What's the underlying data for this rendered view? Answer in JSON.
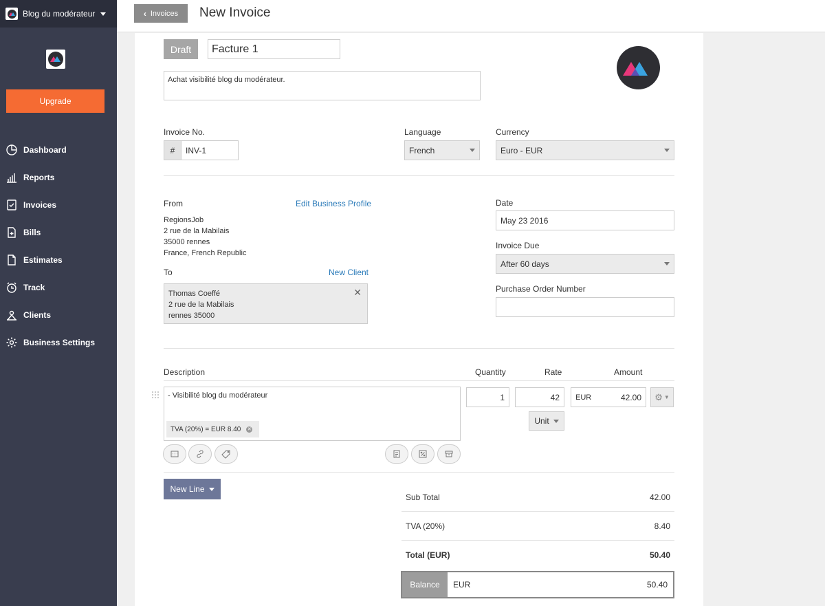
{
  "sidebar": {
    "business_name": "Blog du modérateur",
    "upgrade_label": "Upgrade",
    "items": [
      {
        "label": "Dashboard",
        "icon": "pie-chart-icon"
      },
      {
        "label": "Reports",
        "icon": "bar-chart-icon"
      },
      {
        "label": "Invoices",
        "icon": "invoice-icon"
      },
      {
        "label": "Bills",
        "icon": "bill-icon"
      },
      {
        "label": "Estimates",
        "icon": "document-icon"
      },
      {
        "label": "Track",
        "icon": "clock-icon"
      },
      {
        "label": "Clients",
        "icon": "clients-icon"
      },
      {
        "label": "Business Settings",
        "icon": "gear-icon"
      }
    ]
  },
  "topbar": {
    "back_label": "Invoices",
    "title": "New Invoice"
  },
  "invoice": {
    "status": "Draft",
    "title": "Facture 1",
    "description": "Achat visibilité blog du modérateur.",
    "number_label": "Invoice No.",
    "number_prefix": "#",
    "number": "INV-1",
    "language_label": "Language",
    "language": "French",
    "currency_label": "Currency",
    "currency": "Euro - EUR",
    "from_label": "From",
    "edit_profile_link": "Edit Business Profile",
    "from_address": [
      "RegionsJob",
      "2 rue de la Mabilais",
      "35000 rennes",
      "France, French Republic"
    ],
    "to_label": "To",
    "new_client_link": "New Client",
    "to_address": [
      "Thomas Coeffé",
      "2 rue de la Mabilais",
      "rennes 35000"
    ],
    "date_label": "Date",
    "date": "May 23 2016",
    "due_label": "Invoice Due",
    "due": "After 60 days",
    "po_label": "Purchase Order Number",
    "po_value": ""
  },
  "items": {
    "headers": {
      "description": "Description",
      "quantity": "Quantity",
      "rate": "Rate",
      "amount": "Amount"
    },
    "rows": [
      {
        "description": "- Visibilité blog du modérateur",
        "tax_chip": "TVA (20%) = EUR 8.40",
        "quantity": "1",
        "rate": "42",
        "unit": "Unit",
        "currency": "EUR",
        "amount": "42.00"
      }
    ],
    "new_line_label": "New Line"
  },
  "totals": {
    "subtotal_label": "Sub Total",
    "subtotal": "42.00",
    "tax_label": "TVA (20%)",
    "tax": "8.40",
    "total_label": "Total (EUR)",
    "total": "50.40",
    "balance_label": "Balance",
    "balance_currency": "EUR",
    "balance": "50.40"
  }
}
